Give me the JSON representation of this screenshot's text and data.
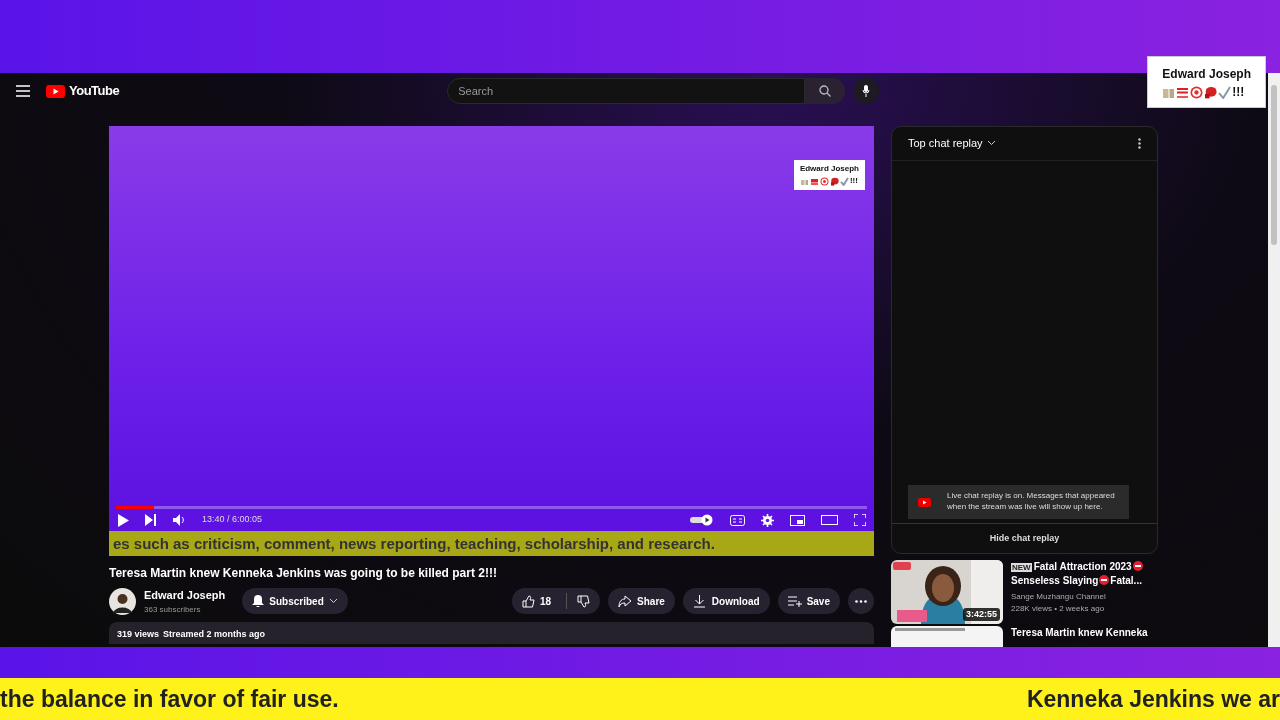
{
  "header": {
    "logo": "YouTube",
    "search": {
      "placeholder": "Search"
    }
  },
  "overlay_card": {
    "name": "Edward Joseph",
    "suffix": "!!!"
  },
  "video": {
    "watermark": {
      "name": "Edward Joseph",
      "suffix": "!!!"
    },
    "progress": {
      "level": 0.05
    },
    "time": "13:40 / 6:00:05",
    "caption": "es such as criticism, comment, news reporting, teaching, scholarship, and research."
  },
  "title": "Teresa Martin knew Kenneka Jenkins was going to be killed part 2!!!",
  "channel": {
    "name": "Edward Joseph",
    "subscribers": "363 subscribers",
    "subscribe_button": "Subscribed"
  },
  "actions": {
    "likes": "18",
    "buttons": [
      {
        "kind": "share",
        "label": "Share"
      },
      {
        "kind": "download",
        "label": "Download"
      },
      {
        "kind": "save",
        "label": "Save"
      }
    ]
  },
  "description": {
    "views": "319 views",
    "date": "Streamed 2 months ago"
  },
  "chat": {
    "title": "Top chat replay",
    "notice": "Live chat replay is on. Messages that appeared when the stream was live will show up here.",
    "hide_button": "Hide chat replay"
  },
  "suggestions": [
    {
      "title_parts": [
        {
          "kind": "badge",
          "text": "NEW"
        },
        {
          "kind": "text",
          "text": "Fatal Attraction 2023"
        },
        {
          "kind": "icon"
        },
        {
          "kind": "text",
          "text": "Senseless Slaying"
        },
        {
          "kind": "icon"
        },
        {
          "kind": "text",
          "text": "Fatal..."
        }
      ],
      "channel": "Sange Muzhangu Channel",
      "meta": "228K views • 2 weeks ago",
      "duration": "3:42:55"
    },
    {
      "title_parts": [
        {
          "kind": "text",
          "text": "Teresa Martin knew Kenneka"
        }
      ]
    }
  ],
  "ticker": {
    "left": "the balance in favor of fair use.",
    "right": "Kenneka Jenkins we ar"
  }
}
